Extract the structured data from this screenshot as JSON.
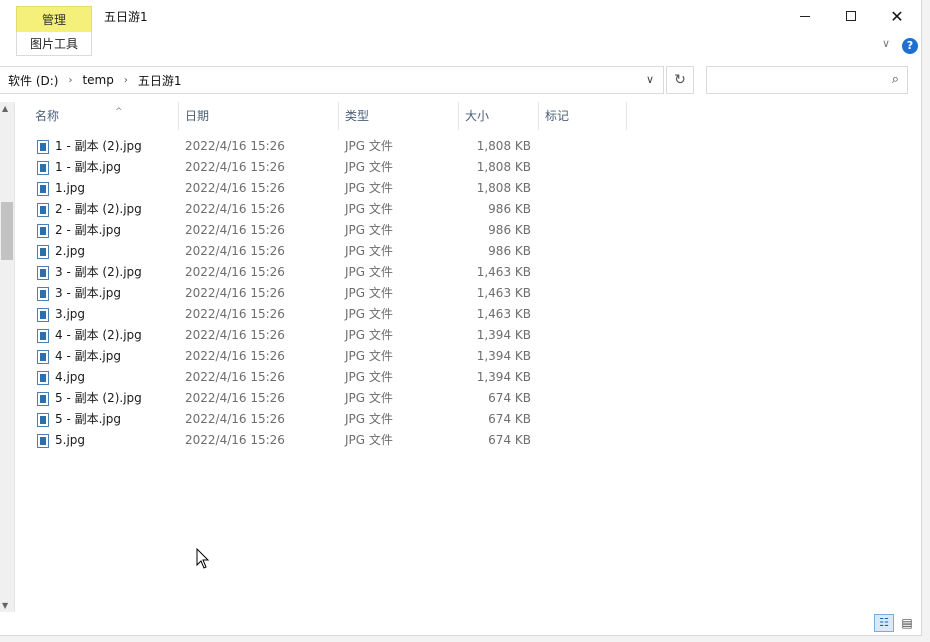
{
  "window": {
    "context_tab_top": "管理",
    "context_tab_bottom": "图片工具",
    "title": "五日游1",
    "minimize_glyph": "—",
    "close_glyph": "✕"
  },
  "ribbon": {
    "chevron_glyph": "∨",
    "help_glyph": "?"
  },
  "address": {
    "crumbs": [
      "软件 (D:)",
      "temp",
      "五日游1"
    ],
    "separator": "›",
    "dropdown_glyph": "∨",
    "refresh_glyph": "↻",
    "search_placeholder": "",
    "search_glyph": "⌕"
  },
  "columns": {
    "name": "名称",
    "date": "日期",
    "type": "类型",
    "size": "大小",
    "tags": "标记",
    "sort_glyph": "^"
  },
  "files": [
    {
      "name": "1 - 副本 (2).jpg",
      "date": "2022/4/16 15:26",
      "type": "JPG 文件",
      "size": "1,808 KB"
    },
    {
      "name": "1 - 副本.jpg",
      "date": "2022/4/16 15:26",
      "type": "JPG 文件",
      "size": "1,808 KB"
    },
    {
      "name": "1.jpg",
      "date": "2022/4/16 15:26",
      "type": "JPG 文件",
      "size": "1,808 KB"
    },
    {
      "name": "2 - 副本 (2).jpg",
      "date": "2022/4/16 15:26",
      "type": "JPG 文件",
      "size": "986 KB"
    },
    {
      "name": "2 - 副本.jpg",
      "date": "2022/4/16 15:26",
      "type": "JPG 文件",
      "size": "986 KB"
    },
    {
      "name": "2.jpg",
      "date": "2022/4/16 15:26",
      "type": "JPG 文件",
      "size": "986 KB"
    },
    {
      "name": "3 - 副本 (2).jpg",
      "date": "2022/4/16 15:26",
      "type": "JPG 文件",
      "size": "1,463 KB"
    },
    {
      "name": "3 - 副本.jpg",
      "date": "2022/4/16 15:26",
      "type": "JPG 文件",
      "size": "1,463 KB"
    },
    {
      "name": "3.jpg",
      "date": "2022/4/16 15:26",
      "type": "JPG 文件",
      "size": "1,463 KB"
    },
    {
      "name": "4 - 副本 (2).jpg",
      "date": "2022/4/16 15:26",
      "type": "JPG 文件",
      "size": "1,394 KB"
    },
    {
      "name": "4 - 副本.jpg",
      "date": "2022/4/16 15:26",
      "type": "JPG 文件",
      "size": "1,394 KB"
    },
    {
      "name": "4.jpg",
      "date": "2022/4/16 15:26",
      "type": "JPG 文件",
      "size": "1,394 KB"
    },
    {
      "name": "5 - 副本 (2).jpg",
      "date": "2022/4/16 15:26",
      "type": "JPG 文件",
      "size": "674 KB"
    },
    {
      "name": "5 - 副本.jpg",
      "date": "2022/4/16 15:26",
      "type": "JPG 文件",
      "size": "674 KB"
    },
    {
      "name": "5.jpg",
      "date": "2022/4/16 15:26",
      "type": "JPG 文件",
      "size": "674 KB"
    }
  ],
  "statusbar": {
    "details_view_glyph": "☷",
    "tiles_view_glyph": "▤"
  },
  "icons": {
    "file": "jpg-file-icon",
    "cursor": "mouse-pointer-icon"
  },
  "colors": {
    "context_tab": "#f5f07a",
    "header_text": "#4c607a",
    "help_blue": "#1f6fd1",
    "file_icon_blue": "#2f6ea9"
  }
}
